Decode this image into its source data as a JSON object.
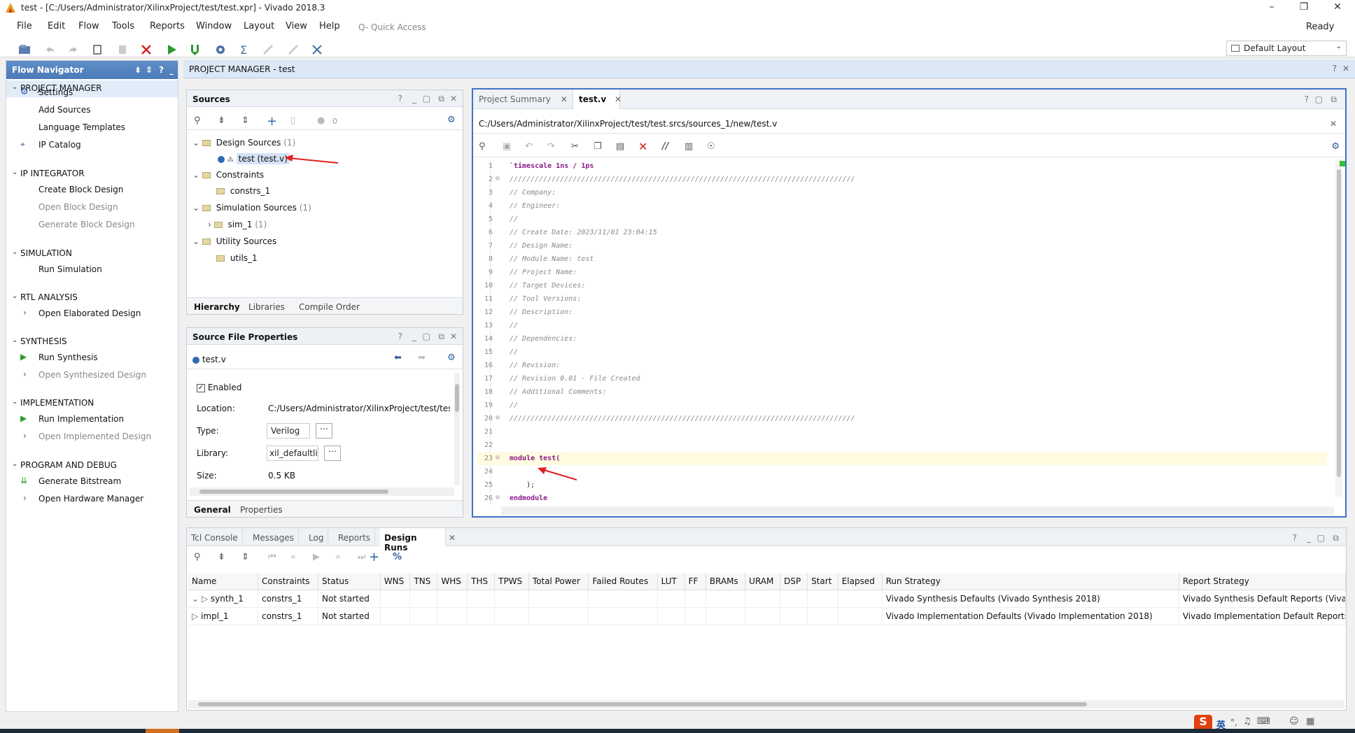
{
  "window": {
    "title": "test - [C:/Users/Administrator/XilinxProject/test/test.xpr] - Vivado 2018.3",
    "status": "Ready"
  },
  "menu": [
    "File",
    "Edit",
    "Flow",
    "Tools",
    "Reports",
    "Window",
    "Layout",
    "View",
    "Help"
  ],
  "quick_access": {
    "placeholder": "Q- Quick Access"
  },
  "layout_select": {
    "value": "Default Layout"
  },
  "flow_navigator": {
    "title": "Flow Navigator",
    "sections": [
      {
        "label": "PROJECT MANAGER",
        "items": [
          {
            "label": "Settings",
            "enabled": true,
            "icon": "gear-icon"
          },
          {
            "label": "Add Sources",
            "enabled": true
          },
          {
            "label": "Language Templates",
            "enabled": true
          },
          {
            "label": "IP Catalog",
            "enabled": true,
            "icon": "ip-icon"
          }
        ]
      },
      {
        "label": "IP INTEGRATOR",
        "items": [
          {
            "label": "Create Block Design",
            "enabled": true
          },
          {
            "label": "Open Block Design",
            "enabled": false
          },
          {
            "label": "Generate Block Design",
            "enabled": false
          }
        ]
      },
      {
        "label": "SIMULATION",
        "items": [
          {
            "label": "Run Simulation",
            "enabled": true
          }
        ]
      },
      {
        "label": "RTL ANALYSIS",
        "items": [
          {
            "label": "Open Elaborated Design",
            "enabled": true
          }
        ]
      },
      {
        "label": "SYNTHESIS",
        "items": [
          {
            "label": "Run Synthesis",
            "enabled": true,
            "icon": "play-icon"
          },
          {
            "label": "Open Synthesized Design",
            "enabled": false
          }
        ]
      },
      {
        "label": "IMPLEMENTATION",
        "items": [
          {
            "label": "Run Implementation",
            "enabled": true,
            "icon": "play-icon"
          },
          {
            "label": "Open Implemented Design",
            "enabled": false
          }
        ]
      },
      {
        "label": "PROGRAM AND DEBUG",
        "items": [
          {
            "label": "Generate Bitstream",
            "enabled": true,
            "icon": "bitstream-icon"
          },
          {
            "label": "Open Hardware Manager",
            "enabled": true
          }
        ]
      }
    ]
  },
  "project_manager_bar": {
    "title": "PROJECT MANAGER - test"
  },
  "sources": {
    "title": "Sources",
    "count_badge": "0",
    "tree": {
      "design_sources": {
        "label": "Design Sources",
        "count": "(1)"
      },
      "top_file": {
        "label": "test",
        "file": "(test.v)"
      },
      "constraints": {
        "label": "Constraints"
      },
      "constrs": {
        "label": "constrs_1"
      },
      "simulation_sources": {
        "label": "Simulation Sources",
        "count": "(1)"
      },
      "sim": {
        "label": "sim_1",
        "count": "(1)"
      },
      "utility_sources": {
        "label": "Utility Sources"
      },
      "utils": {
        "label": "utils_1"
      }
    },
    "tabs": [
      "Hierarchy",
      "Libraries",
      "Compile Order"
    ]
  },
  "source_file_properties": {
    "title": "Source File Properties",
    "file": "test.v",
    "enabled_label": "Enabled",
    "location_label": "Location:",
    "location_value": "C:/Users/Administrator/XilinxProject/test/test.src",
    "type_label": "Type:",
    "type_value": "Verilog",
    "library_label": "Library:",
    "library_value": "xil_defaultlib",
    "size_label": "Size:",
    "size_value": "0.5 KB",
    "tabs": [
      "General",
      "Properties"
    ]
  },
  "editor": {
    "tabs": [
      "Project Summary",
      "test.v"
    ],
    "path": "C:/Users/Administrator/XilinxProject/test/test.srcs/sources_1/new/test.v",
    "lines": [
      "`timescale 1ns / 1ps",
      "//////////////////////////////////////////////////////////////////////////////////",
      "// Company:",
      "// Engineer:",
      "//",
      "// Create Date: 2023/11/01 23:04:15",
      "// Design Name:",
      "// Module Name: test",
      "// Project Name:",
      "// Target Devices:",
      "// Tool Versions:",
      "// Description:",
      "//",
      "// Dependencies:",
      "//",
      "// Revision:",
      "// Revision 0.01 - File Created",
      "// Additional Comments:",
      "//",
      "//////////////////////////////////////////////////////////////////////////////////",
      "",
      "",
      "module test(",
      "",
      "    );",
      "endmodule"
    ]
  },
  "bottom_panel": {
    "tabs": [
      "Tcl Console",
      "Messages",
      "Log",
      "Reports",
      "Design Runs"
    ],
    "columns": [
      "Name",
      "Constraints",
      "Status",
      "WNS",
      "TNS",
      "WHS",
      "THS",
      "TPWS",
      "Total Power",
      "Failed Routes",
      "LUT",
      "FF",
      "BRAMs",
      "URAM",
      "DSP",
      "Start",
      "Elapsed",
      "Run Strategy",
      "Report Strategy"
    ],
    "rows": [
      {
        "name": "synth_1",
        "constraints": "constrs_1",
        "status": "Not started",
        "run_strategy": "Vivado Synthesis Defaults (Vivado Synthesis 2018)",
        "report_strategy": "Vivado Synthesis Default Reports (Vivado Synthe"
      },
      {
        "name": "impl_1",
        "constraints": "constrs_1",
        "status": "Not started",
        "run_strategy": "Vivado Implementation Defaults (Vivado Implementation 2018)",
        "report_strategy": "Vivado Implementation Default Reports (Vivado I"
      }
    ]
  },
  "ime": {
    "label": "英"
  },
  "colors": {
    "accent": "#3f74c6",
    "nav_header": "#4b7ab8",
    "play_green": "#2e9b2e",
    "stop_red": "#d42020",
    "arrow_red": "#e02020"
  }
}
